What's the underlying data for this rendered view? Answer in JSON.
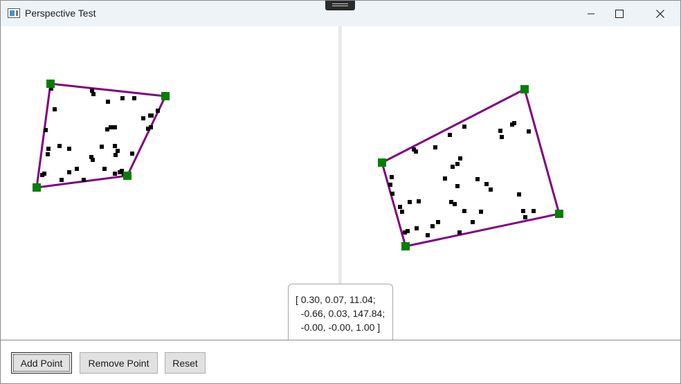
{
  "window": {
    "title": "Perspective Test",
    "caption_buttons": [
      "minimize",
      "maximize",
      "close"
    ]
  },
  "matrix": {
    "lines": [
      "[ 0.30, 0.07, 11.04;",
      "  -0.66, 0.03, 147.84;",
      "  -0.00, -0.00, 1.00 ]"
    ]
  },
  "toolbar": {
    "add_point_label": "Add Point",
    "remove_point_label": "Remove Point",
    "reset_label": "Reset"
  },
  "colors": {
    "quad_stroke": "#800080",
    "handle_fill": "#008000",
    "point_fill": "#000000",
    "titlebar_bg": "#eef3f8"
  }
}
